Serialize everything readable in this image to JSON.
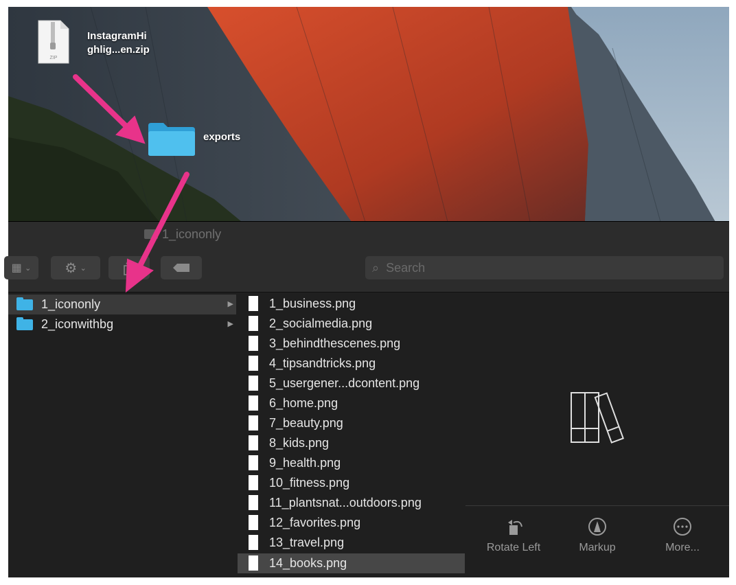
{
  "desktop": {
    "zip_label_line1": "InstagramHi",
    "zip_label_line2": "ghlig...en.zip",
    "zip_badge": "ZIP",
    "folder_label": "exports"
  },
  "finder": {
    "title": "1_icononly",
    "search_placeholder": "Search",
    "sidebar": [
      {
        "label": "1_icononly",
        "selected": true
      },
      {
        "label": "2_iconwithbg",
        "selected": false
      }
    ],
    "files": [
      "1_business.png",
      "2_socialmedia.png",
      "3_behindthescenes.png",
      "4_tipsandtricks.png",
      "5_usergener...dcontent.png",
      "6_home.png",
      "7_beauty.png",
      "8_kids.png",
      "9_health.png",
      "10_fitness.png",
      "11_plantsnat...outdoors.png",
      "12_favorites.png",
      "13_travel.png",
      "14_books.png"
    ],
    "selected_file": "14_books.png",
    "actions": {
      "rotate": "Rotate Left",
      "markup": "Markup",
      "more": "More..."
    }
  },
  "colors": {
    "arrow": "#e8338a",
    "folder": "#3fb3e6",
    "window_bg": "#1f1f1f"
  }
}
